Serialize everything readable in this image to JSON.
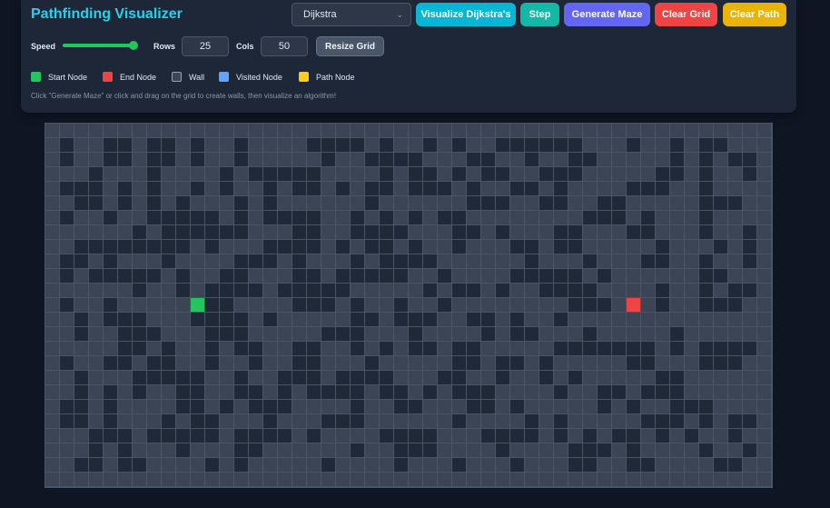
{
  "header": {
    "title": "Pathfinding Visualizer"
  },
  "controls": {
    "algorithm": {
      "selected": "Dijkstra"
    },
    "buttons": {
      "visualize": "Visualize Dijkstra's",
      "step": "Step",
      "generate_maze": "Generate Maze",
      "clear_grid": "Clear Grid",
      "clear_path": "Clear Path"
    },
    "speed_label": "Speed",
    "speed_level": 0.9,
    "rows_label": "Rows",
    "rows_value": "25",
    "cols_label": "Cols",
    "cols_value": "50",
    "resize_button": "Resize Grid"
  },
  "legend": [
    {
      "label": "Start Node",
      "color": "#22c55e"
    },
    {
      "label": "End Node",
      "color": "#ef4444"
    },
    {
      "label": "Wall",
      "color": "#3b4556"
    },
    {
      "label": "Visited Node",
      "color": "#60a5fa"
    },
    {
      "label": "Path Node",
      "color": "#facc15"
    }
  ],
  "hint": "Click \"Generate Maze\" or click and drag on the grid to create walls, then visualize an algorithm!",
  "grid": {
    "rows": 25,
    "cols": 50,
    "start": {
      "row": 12,
      "col": 10
    },
    "end": {
      "row": 12,
      "col": 40
    }
  }
}
